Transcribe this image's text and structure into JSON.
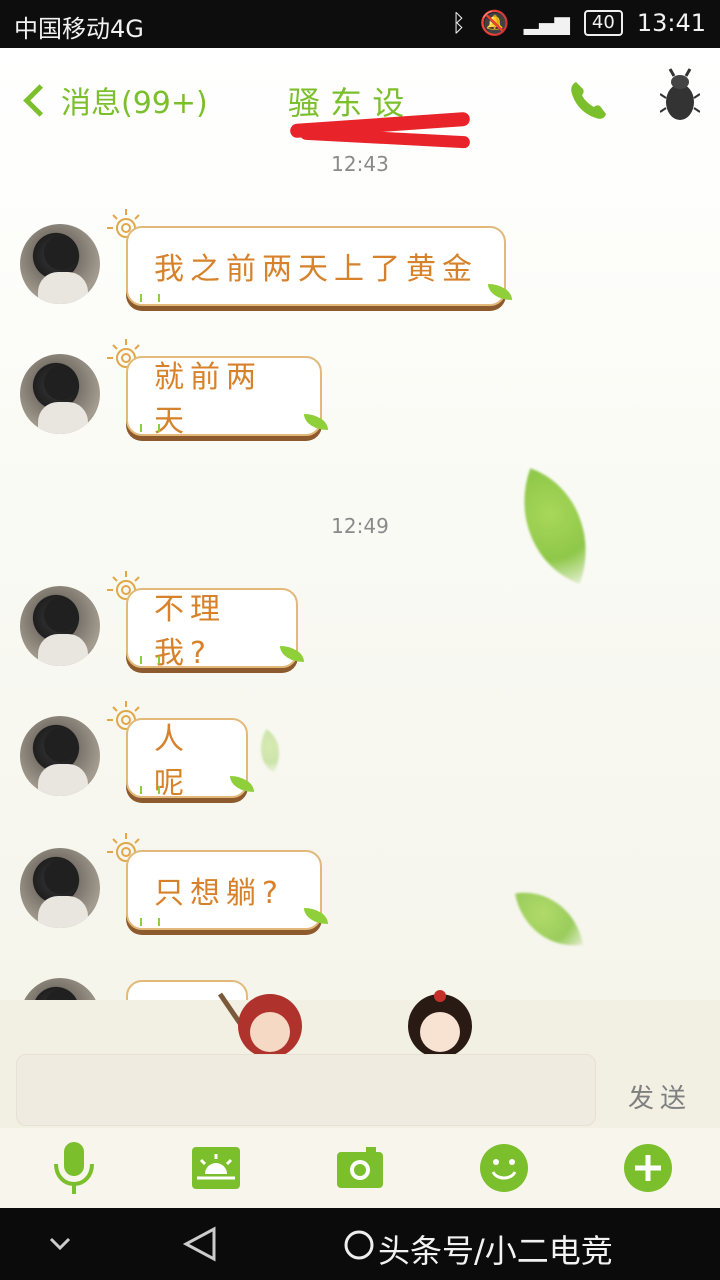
{
  "status_bar": {
    "carrier": "中国移动4G",
    "time": "13:41",
    "battery": "40",
    "network": "4G"
  },
  "header": {
    "back_label": "消息(99+)",
    "title": "骚 东 设"
  },
  "conversation": {
    "timestamps": [
      "12:43",
      "12:49"
    ],
    "messages": [
      {
        "text": "我之前两天上了黄金"
      },
      {
        "text": "就前两天"
      },
      {
        "text": "不理我?"
      },
      {
        "text": "人呢"
      },
      {
        "text": "只想躺?"
      }
    ]
  },
  "composer": {
    "send_label": "发送",
    "placeholder": ""
  },
  "toolbar": {
    "icons": [
      "microphone-icon",
      "scene-icon",
      "camera-icon",
      "emoji-icon",
      "plus-icon"
    ]
  },
  "navbar": {
    "watermark": "头条号/小二电竞"
  },
  "colors": {
    "accent": "#7cbf2c",
    "bubble_text": "#d7822a",
    "redaction": "#e8242a"
  }
}
